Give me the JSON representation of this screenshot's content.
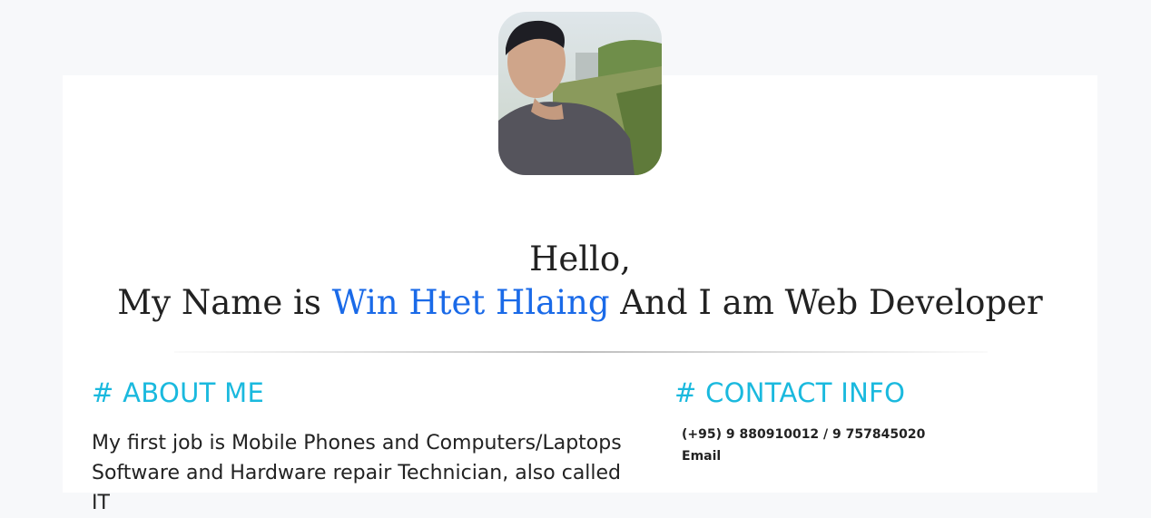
{
  "hero": {
    "greeting": "Hello,",
    "intro_prefix": "My Name is ",
    "name": "Win Htet Hlaing",
    "intro_suffix": " And I am Web Developer"
  },
  "about": {
    "title": "# ABOUT ME",
    "text": "My first job is Mobile Phones and Computers/Laptops Software and Hardware repair Technician, also called IT"
  },
  "contact": {
    "title": "# CONTACT INFO",
    "phone": "(+95) 9 880910012 / 9 757845020",
    "email_label": "Email"
  },
  "colors": {
    "accent": "#1ab9de",
    "name": "#1a6ae8",
    "background": "#f7f8fa",
    "card": "#ffffff"
  },
  "icons": {
    "avatar": "profile-photo"
  }
}
